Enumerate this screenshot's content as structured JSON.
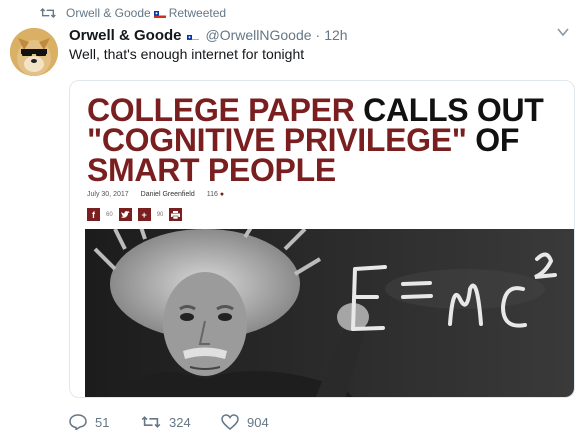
{
  "retweet_context": {
    "user": "Orwell & Goode",
    "label": "Retweeted"
  },
  "tweet": {
    "display_name": "Orwell & Goode",
    "handle": "@OrwellNGoode",
    "separator": "·",
    "time": "12h",
    "text": "Well, that's enough internet for tonight"
  },
  "article": {
    "headline_red_1": "COLLEGE PAPER",
    "headline_black_1": " CALLS OUT",
    "headline_red_2": "\"COGNITIVE PRIVILEGE\"",
    "headline_black_2": " OF",
    "headline_red_3": "SMART PEOPLE",
    "date": "July 30, 2017",
    "author": "Daniel Greenfield",
    "comments": "116",
    "facebook_count": "60",
    "plus_count": "90",
    "equation": "E = mc²"
  },
  "actions": {
    "replies": "51",
    "retweets": "324",
    "likes": "904"
  },
  "colors": {
    "accent_red": "#7a1f20",
    "meta_gray": "#657786"
  },
  "icons": {
    "retweet": "retweet-icon",
    "flag": "chile-flag-icon",
    "caret": "chevron-down-icon",
    "reply": "reply-icon",
    "like": "heart-icon"
  }
}
